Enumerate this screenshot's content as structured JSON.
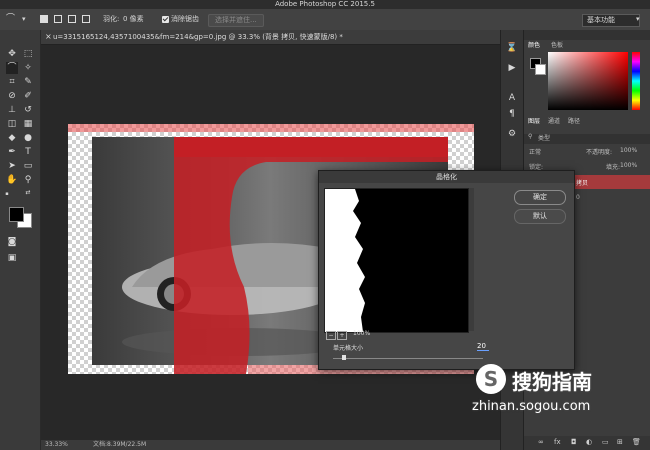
{
  "app": {
    "title": "Adobe Photoshop CC 2015.5"
  },
  "options_bar": {
    "feather_label": "羽化:",
    "feather_value": "0 像素",
    "antialias_label": "消除锯齿",
    "select_mask_button": "选择并遮住...",
    "workspace_value": "基本功能"
  },
  "document": {
    "tab_title": "u=3315165124,4357100435&fm=214&gp=0.jpg @ 33.3% (背景 拷贝, 快速蒙版/8) *",
    "zoom": "33.33%",
    "doc_size": "文档:8.39M/22.5M"
  },
  "panels": {
    "color_tab": "颜色",
    "swatches_tab": "色板",
    "layers_tab": "图层",
    "channels_tab": "通道",
    "paths_tab": "路径",
    "kind_filter": "类型",
    "blend_mode": "正常",
    "opacity_label": "不透明度:",
    "opacity_value": "100%",
    "lock_label": "锁定:",
    "fill_label": "填充:",
    "fill_value": "100%",
    "layer_copy_name": "拷贝",
    "layer_bg_name": "0"
  },
  "dialog": {
    "title": "晶格化",
    "ok_button": "确定",
    "cancel_button": "默认",
    "zoom_value": "100%",
    "cell_size_label": "单元格大小",
    "cell_size_value": "20",
    "cell_size_fraction": 0.06
  },
  "watermark": {
    "brand": "搜狗指南",
    "url": "zhinan.sogou.com"
  },
  "colors": {
    "mask_red": "#c42025",
    "accent": "#ff0000",
    "selected_layer": "#a53a3c"
  }
}
